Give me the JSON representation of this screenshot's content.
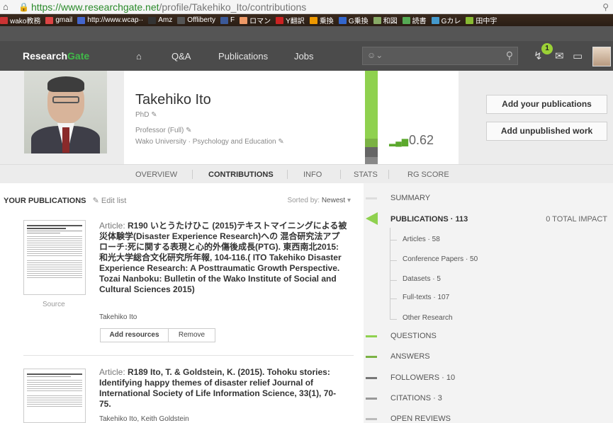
{
  "browser": {
    "url_secure": "https://www.",
    "url_domain": "researchgate.net",
    "url_path": "/profile/Takehiko_Ito/contributions",
    "bookmarks": [
      {
        "label": "wako教務",
        "color": "#c33"
      },
      {
        "label": "gmail",
        "color": "#d44"
      },
      {
        "label": "http://www.wcap··",
        "color": "#46c"
      },
      {
        "label": "Amz",
        "color": "#333"
      },
      {
        "label": "Offliberty",
        "color": "#555"
      },
      {
        "label": "F",
        "color": "#3b5998"
      },
      {
        "label": "ロマン",
        "color": "#e96"
      },
      {
        "label": "Y翻訳",
        "color": "#c22"
      },
      {
        "label": "乗換",
        "color": "#e90"
      },
      {
        "label": "G乗換",
        "color": "#36c"
      },
      {
        "label": "和図",
        "color": "#8a6"
      },
      {
        "label": "読書",
        "color": "#5a5"
      },
      {
        "label": "Gカレ",
        "color": "#49c"
      },
      {
        "label": "田中宇",
        "color": "#8b3"
      }
    ]
  },
  "nav": {
    "logo_main": "Research",
    "logo_accent": "Gate",
    "items": [
      "Q&A",
      "Publications",
      "Jobs"
    ],
    "notification_count": "1"
  },
  "profile": {
    "name": "Takehiko Ito",
    "degree": "PhD",
    "position": "Professor (Full)",
    "affiliation": "Wako University · Psychology and Education",
    "rg_score": "0.62",
    "actions": [
      "Add your publications",
      "Add unpublished work"
    ]
  },
  "tabs": [
    "OVERVIEW",
    "CONTRIBUTIONS",
    "INFO",
    "STATS",
    "RG SCORE"
  ],
  "publications": {
    "heading": "YOUR PUBLICATIONS",
    "edit_label": "Edit list",
    "sorted_label": "Sorted by:",
    "sorted_value": "Newest",
    "items": [
      {
        "kind": "Article: ",
        "title": "R190 いとうたけひこ (2015)テキストマイニングによる被災体験学(Disaster Experience Research)への 混合研究法アプローチ:死に関する表現と心的外傷後成長(PTG). 東西南北2015:和光大学総合文化研究所年報, 104-116.( ITO Takehiko Disaster Experience Research: A Posttraumatic Growth Perspective. Tozai Nanboku: Bulletin of the Wako Institute of Social and Cultural Sciences 2015)",
        "authors": "Takehiko Ito",
        "source": "Source",
        "buttons": [
          "Add resources",
          "Remove"
        ]
      },
      {
        "kind": "Article: ",
        "title": "R189 Ito, T. & Goldstein, K. (2015). Tohoku stories: Identifying happy themes of disaster relief Journal of International Society of Life Information Science, 33(1), 70-75.",
        "authors": "Takehiko Ito, Keith Goldstein"
      }
    ]
  },
  "stats": {
    "summary": "SUMMARY",
    "publications": "PUBLICATIONS · 113",
    "total_impact": "0 TOTAL IMPACT",
    "sub_items": [
      "Articles · 58",
      "Conference Papers · 50",
      "Datasets · 5",
      "Full-texts · 107",
      "Other Research"
    ],
    "questions": "QUESTIONS",
    "answers": "ANSWERS",
    "followers": "FOLLOWERS · 10",
    "citations": "CITATIONS · 3",
    "open_reviews": "OPEN REVIEWS",
    "colors": {
      "accent": "#8fd14f",
      "grey": "#777"
    }
  }
}
